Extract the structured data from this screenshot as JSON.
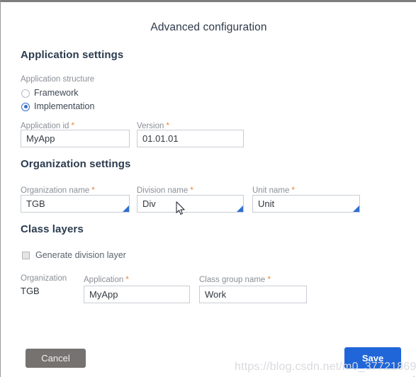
{
  "dialog": {
    "title": "Advanced configuration"
  },
  "sections": {
    "application": {
      "heading": "Application settings",
      "structure_label": "Application structure",
      "options": [
        {
          "label": "Framework",
          "selected": false
        },
        {
          "label": "Implementation",
          "selected": true
        }
      ],
      "fields": {
        "app_id": {
          "label": "Application id",
          "required_marker": "*",
          "value": "MyApp"
        },
        "version": {
          "label": "Version",
          "required_marker": "*",
          "value": "01.01.01"
        }
      }
    },
    "organization": {
      "heading": "Organization settings",
      "fields": {
        "org_name": {
          "label": "Organization name",
          "required_marker": "*",
          "value": "TGB"
        },
        "division_name": {
          "label": "Division name",
          "required_marker": "*",
          "value": "Div"
        },
        "unit_name": {
          "label": "Unit name",
          "required_marker": "*",
          "value": "Unit"
        }
      }
    },
    "class_layers": {
      "heading": "Class layers",
      "checkbox": {
        "label": "Generate division layer",
        "checked": false
      },
      "fields": {
        "organization": {
          "label": "Organization",
          "value": "TGB"
        },
        "application": {
          "label": "Application",
          "required_marker": "*",
          "value": "MyApp"
        },
        "class_group_name": {
          "label": "Class group name",
          "required_marker": "*",
          "value": "Work"
        }
      }
    }
  },
  "footer": {
    "cancel_label": "Cancel",
    "save_label": "Save"
  },
  "watermark": {
    "text": "https://blog.csdn.net/m0_37721869"
  },
  "colors": {
    "accent_blue": "#2066d8",
    "radio_blue": "#2f6fd0",
    "required_orange": "#e8883a",
    "cancel_gray": "#76726f",
    "heading_text": "#2b3b4e",
    "label_gray": "#8a8f97"
  }
}
